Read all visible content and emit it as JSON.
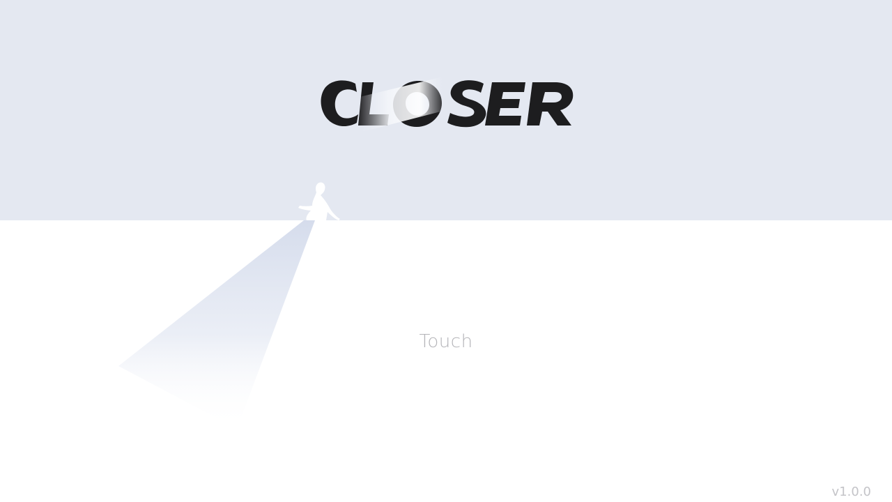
{
  "game": {
    "logo_text": "CLOSER",
    "prompt": "Touch",
    "version": "v1.0.0"
  },
  "colors": {
    "sky": "#e4e8f1",
    "ground": "#ffffff",
    "logo": "#1d1d1f",
    "beam": "#d5dcec",
    "prompt_text": "#b4b4b8",
    "version_text": "#c4c4c8"
  },
  "icons": {
    "figure": "sitting-girl-silhouette"
  }
}
